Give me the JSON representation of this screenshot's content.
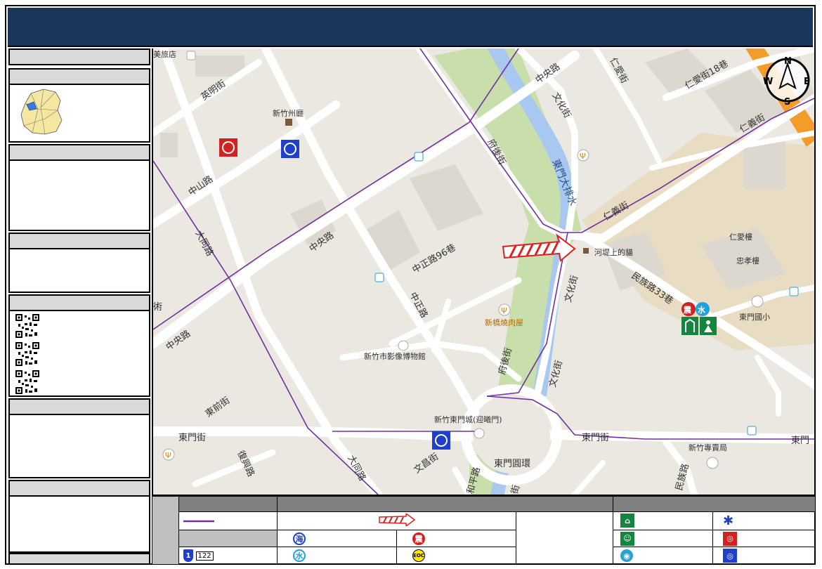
{
  "map": {
    "streets": {
      "zhongshan": "中山路",
      "datong_1": "大同路",
      "datong_2": "大同路",
      "zhongyang_1": "中央路",
      "zhongyang_2": "中央路",
      "zhongyang_3": "中央路",
      "zhongzheng": "中正路",
      "zhongzheng96": "中正路96巷",
      "yingming": "英明街",
      "fuhou_1": "府後街",
      "fuhou_2": "府後街",
      "wenhua_1": "文化街",
      "wenhua_2": "文化街",
      "wenhua_3": "文化街",
      "renyi_1": "仁義街",
      "renyi_2": "仁義街",
      "renai": "仁愛街",
      "renai18": "仁愛街18巷",
      "minzu33": "民族路33巷",
      "minzu": "民族路",
      "dongmen_w": "東門街",
      "dongmen_e": "東門街",
      "dongmen_far": "東門",
      "dongmen_circle": "東門圓環",
      "dongqian": "東前街",
      "fuxing": "復興路",
      "wenchang": "文昌街",
      "heping": "和平路",
      "canal": "東門大排水",
      "side_street": "街",
      "lane_left": "術"
    },
    "pois": {
      "hotel": "美旅店",
      "county_hall": "新竹州廳",
      "cat": "河堤上的貓",
      "bbq": "新橋燒肉屋",
      "museum": "新竹市影像博物館",
      "gate": "新竹東門城(迎曦門)",
      "renai_bldg": "仁愛樓",
      "zhongxiao_bldg": "忠孝樓",
      "school": "東門國小",
      "tobacco": "新竹專賣局"
    },
    "compass": {
      "n": "N",
      "e": "E",
      "s": "S",
      "w": "W"
    },
    "icons": {
      "quake": "震",
      "water": "水",
      "sea": "海",
      "eoc": "EOC",
      "route_no": "122",
      "shield_no": "1"
    },
    "colors": {
      "title_bar": "#1a365d",
      "road": "#ffffff",
      "park": "#c9dfab",
      "water": "#a8c8ef",
      "building": "#ddd8cf",
      "campus": "#e8dcc2",
      "freeway": "#f39c2a",
      "route_line": "#7030a0",
      "arrow": "#e02020",
      "police_blue": "#1f3fcf",
      "fire_red": "#d32020",
      "shelter_green": "#14853e"
    }
  }
}
